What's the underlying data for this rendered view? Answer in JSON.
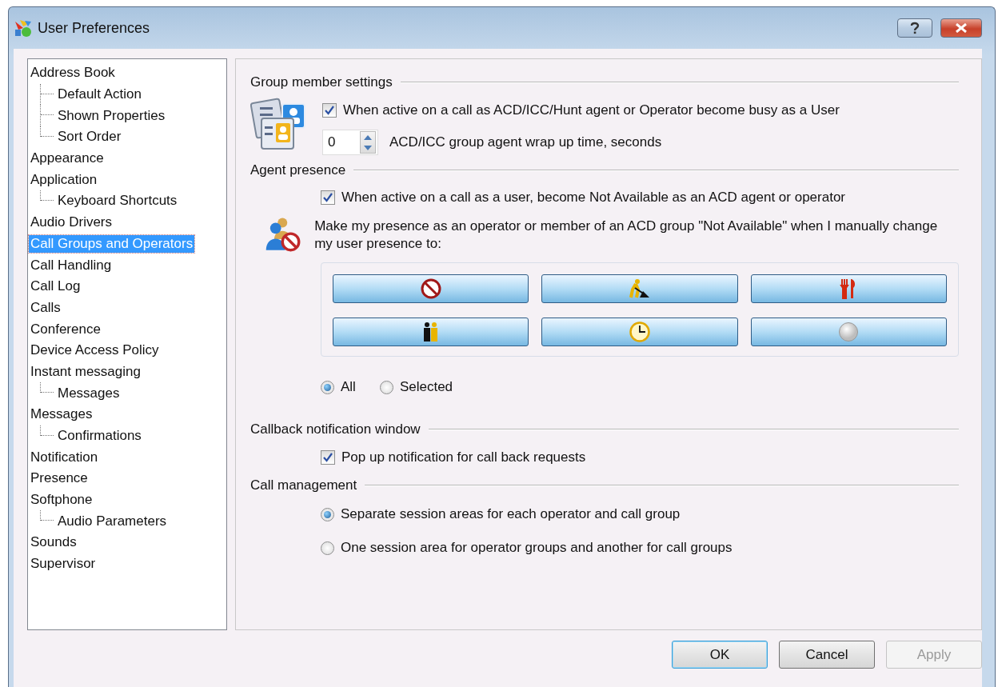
{
  "window": {
    "title": "User Preferences"
  },
  "tree": [
    {
      "label": "Address Book",
      "selected": false,
      "children": [
        {
          "label": "Default Action",
          "selected": false
        },
        {
          "label": "Shown Properties",
          "selected": false
        },
        {
          "label": "Sort Order",
          "selected": false
        }
      ]
    },
    {
      "label": "Appearance",
      "selected": false
    },
    {
      "label": "Application",
      "selected": false,
      "children": [
        {
          "label": "Keyboard Shortcuts",
          "selected": false
        }
      ]
    },
    {
      "label": "Audio Drivers",
      "selected": false
    },
    {
      "label": "Call Groups and Operators",
      "selected": true
    },
    {
      "label": "Call Handling",
      "selected": false
    },
    {
      "label": "Call Log",
      "selected": false
    },
    {
      "label": "Calls",
      "selected": false
    },
    {
      "label": "Conference",
      "selected": false
    },
    {
      "label": "Device Access Policy",
      "selected": false
    },
    {
      "label": "Instant messaging",
      "selected": false,
      "children": [
        {
          "label": "Messages",
          "selected": false
        }
      ]
    },
    {
      "label": "Messages",
      "selected": false,
      "children": [
        {
          "label": "Confirmations",
          "selected": false
        }
      ]
    },
    {
      "label": "Notification",
      "selected": false
    },
    {
      "label": "Presence",
      "selected": false
    },
    {
      "label": "Softphone",
      "selected": false,
      "children": [
        {
          "label": "Audio Parameters",
          "selected": false
        }
      ]
    },
    {
      "label": "Sounds",
      "selected": false
    },
    {
      "label": "Supervisor",
      "selected": false
    }
  ],
  "group_member_settings": {
    "heading": "Group member settings",
    "busy_checkbox": {
      "label": "When active on a call as ACD/ICC/Hunt agent or Operator become busy as a User",
      "checked": true
    },
    "wrap_up": {
      "value": "0",
      "label": "ACD/ICC group agent wrap up time, seconds"
    }
  },
  "agent_presence": {
    "heading": "Agent presence",
    "checkbox": {
      "label": "When active on a call as a user, become Not Available as an ACD agent or operator",
      "checked": true
    },
    "description": "Make my presence as an operator or member of an ACD group \"Not Available\" when I manually change my user presence to:",
    "presence_buttons": [
      {
        "kind": "blocked"
      },
      {
        "kind": "working"
      },
      {
        "kind": "lunch"
      },
      {
        "kind": "meeting"
      },
      {
        "kind": "clock"
      },
      {
        "kind": "offline"
      }
    ],
    "scope": [
      {
        "label": "All",
        "selected": true
      },
      {
        "label": "Selected",
        "selected": false
      }
    ]
  },
  "callback_notification": {
    "heading": "Callback notification window",
    "checkbox": {
      "label": "Pop up notification for call back requests",
      "checked": true
    }
  },
  "call_management": {
    "heading": "Call management",
    "options": [
      {
        "label": "Separate session areas for each operator and call group",
        "selected": true
      },
      {
        "label": "One session area for operator groups and another for call groups",
        "selected": false
      }
    ]
  },
  "buttons": [
    {
      "label": "OK",
      "kind": "default",
      "disabled": false
    },
    {
      "label": "Cancel",
      "kind": "normal",
      "disabled": false
    },
    {
      "label": "Apply",
      "kind": "normal",
      "disabled": true
    }
  ]
}
